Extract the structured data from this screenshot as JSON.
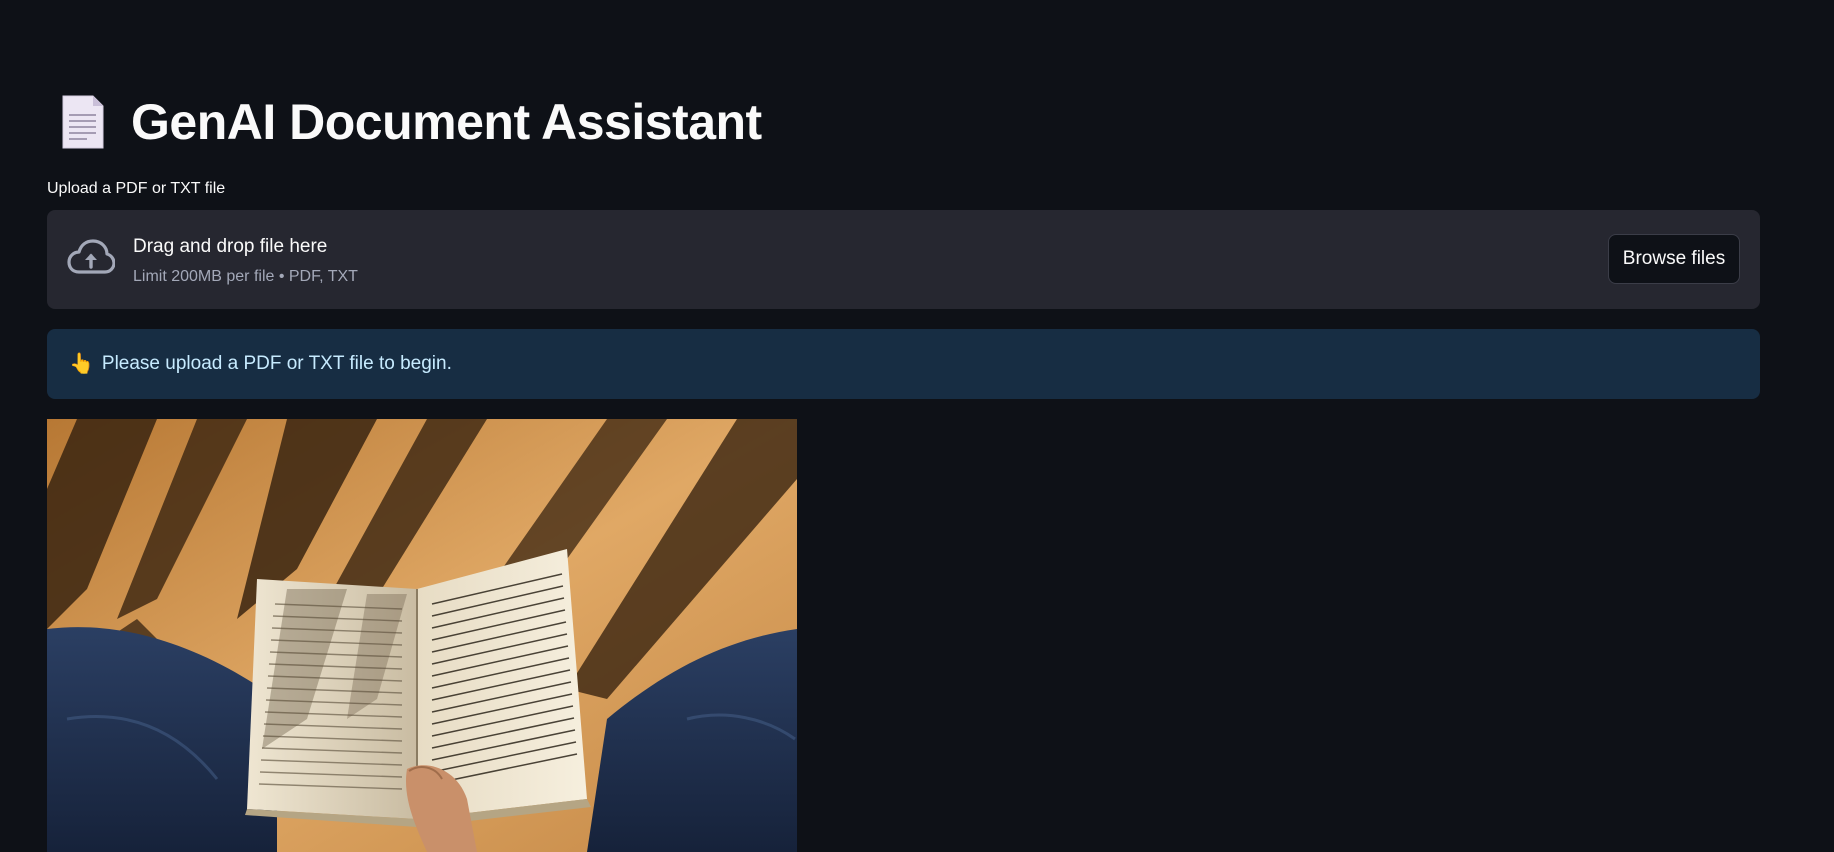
{
  "page": {
    "title": "GenAI Document Assistant",
    "title_icon": "page-facing-up-icon"
  },
  "uploader": {
    "label": "Upload a PDF or TXT file",
    "instructions": "Drag and drop file here",
    "limit_text": "Limit 200MB per file • PDF, TXT",
    "browse_label": "Browse files",
    "icon": "cloud-upload-icon"
  },
  "info": {
    "emoji": "👆",
    "text": "Please upload a PDF or TXT file to begin."
  },
  "image": {
    "subject": "person-reading-open-book-icon"
  },
  "colors": {
    "background": "#0e1117",
    "dropzone": "#262730",
    "info_bg": "#172d43",
    "info_text": "#c7ebff",
    "muted_text": "#a3a8b8"
  }
}
